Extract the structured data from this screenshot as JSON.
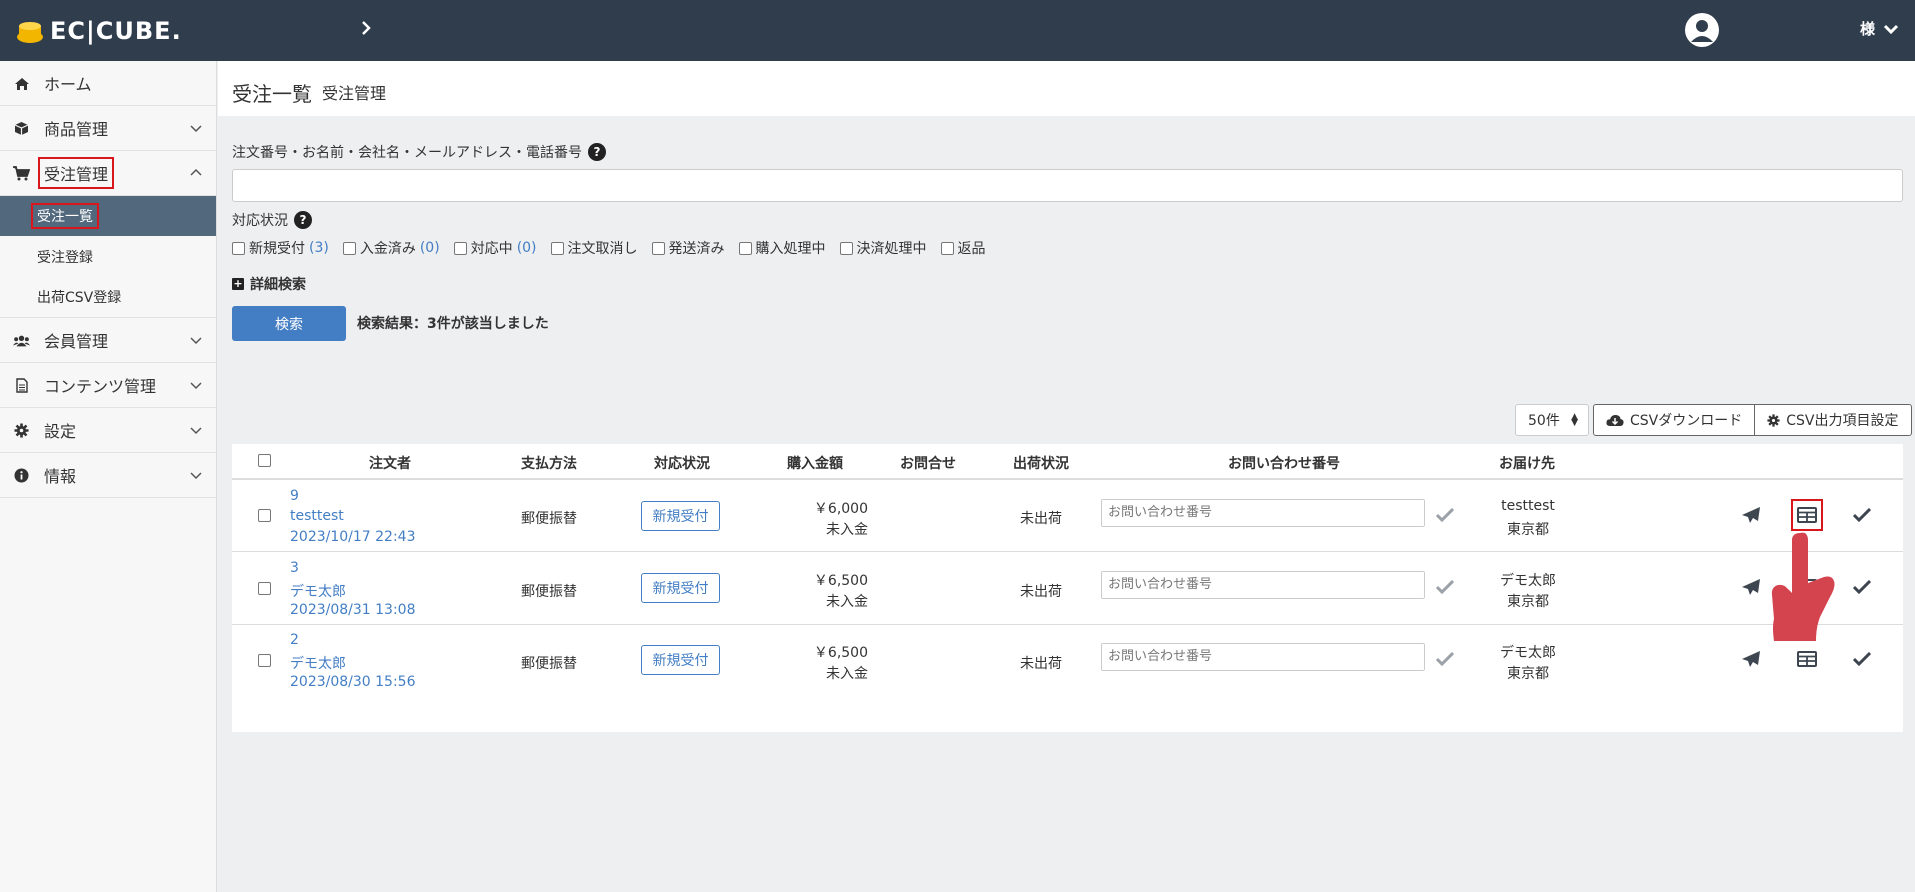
{
  "brand": {
    "logo_text": "EC|CUBE."
  },
  "header": {
    "user_name": "様"
  },
  "sidebar": {
    "items": [
      {
        "label": "ホーム",
        "icon": "home-icon"
      },
      {
        "label": "商品管理",
        "icon": "cube-icon"
      },
      {
        "label": "受注管理",
        "icon": "cart-icon"
      },
      {
        "label": "会員管理",
        "icon": "users-icon"
      },
      {
        "label": "コンテンツ管理",
        "icon": "file-icon"
      },
      {
        "label": "設定",
        "icon": "gear-icon"
      },
      {
        "label": "情報",
        "icon": "info-icon"
      }
    ],
    "sub_items": [
      {
        "label": "受注一覧"
      },
      {
        "label": "受注登録"
      },
      {
        "label": "出荷CSV登録"
      }
    ]
  },
  "page": {
    "title": "受注一覧",
    "subtitle": "受注管理"
  },
  "search": {
    "label": "注文番号・お名前・会社名・メールアドレス・電話番号",
    "value": "",
    "status_label": "対応状況",
    "statuses": [
      {
        "label": "新規受付",
        "count": "(3)"
      },
      {
        "label": "入金済み",
        "count": "(0)"
      },
      {
        "label": "対応中",
        "count": "(0)"
      },
      {
        "label": "注文取消し",
        "count": ""
      },
      {
        "label": "発送済み",
        "count": ""
      },
      {
        "label": "購入処理中",
        "count": ""
      },
      {
        "label": "決済処理中",
        "count": ""
      },
      {
        "label": "返品",
        "count": ""
      }
    ],
    "advanced_label": "詳細検索",
    "button_label": "検索",
    "result_text": "検索結果：3件が該当しました"
  },
  "toolbar": {
    "per_page": "50件",
    "csv_download": "CSVダウンロード",
    "csv_settings": "CSV出力項目設定"
  },
  "table": {
    "headers": [
      "注文者",
      "支払方法",
      "対応状況",
      "購入金額",
      "お問合せ",
      "出荷状況",
      "お問い合わせ番号",
      "お届け先"
    ],
    "rows": [
      {
        "order_no": "9",
        "customer": "testtest",
        "date": "2023/10/17 22:43",
        "payment": "郵便振替",
        "status": "新規受付",
        "amount": "￥6,000",
        "pay_state": "未入金",
        "ship_state": "未出荷",
        "inquiry_placeholder": "お問い合わせ番号",
        "dest_name": "testtest",
        "dest_pref": "東京都"
      },
      {
        "order_no": "3",
        "customer": "デモ太郎",
        "date": "2023/08/31 13:08",
        "payment": "郵便振替",
        "status": "新規受付",
        "amount": "￥6,500",
        "pay_state": "未入金",
        "ship_state": "未出荷",
        "inquiry_placeholder": "お問い合わせ番号",
        "dest_name": "デモ太郎",
        "dest_pref": "東京都"
      },
      {
        "order_no": "2",
        "customer": "デモ太郎",
        "date": "2023/08/30 15:56",
        "payment": "郵便振替",
        "status": "新規受付",
        "amount": "￥6,500",
        "pay_state": "未入金",
        "ship_state": "未出荷",
        "inquiry_placeholder": "お問い合わせ番号",
        "dest_name": "デモ太郎",
        "dest_pref": "東京都"
      }
    ]
  },
  "colors": {
    "topbar": "#2f3d4c",
    "accent": "#437ec4",
    "highlight": "#d9161c",
    "active_sub": "#52687c"
  }
}
